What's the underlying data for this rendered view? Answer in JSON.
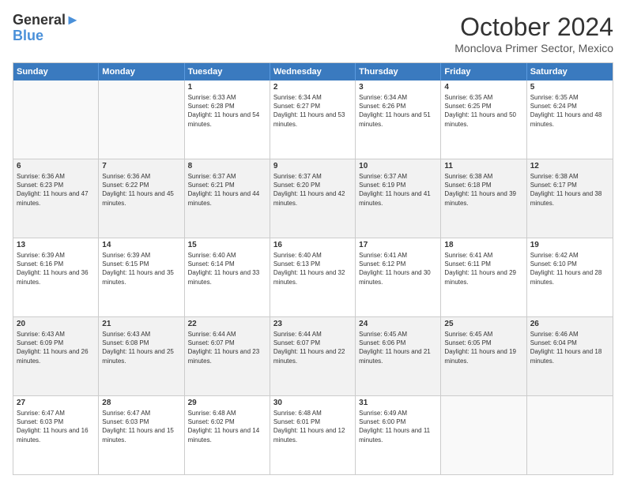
{
  "header": {
    "logo_line1": "General",
    "logo_line2": "Blue",
    "month": "October 2024",
    "location": "Monclova Primer Sector, Mexico"
  },
  "weekdays": [
    "Sunday",
    "Monday",
    "Tuesday",
    "Wednesday",
    "Thursday",
    "Friday",
    "Saturday"
  ],
  "weeks": [
    [
      {
        "day": "",
        "info": "",
        "empty": true
      },
      {
        "day": "",
        "info": "",
        "empty": true
      },
      {
        "day": "1",
        "info": "Sunrise: 6:33 AM\nSunset: 6:28 PM\nDaylight: 11 hours and 54 minutes."
      },
      {
        "day": "2",
        "info": "Sunrise: 6:34 AM\nSunset: 6:27 PM\nDaylight: 11 hours and 53 minutes."
      },
      {
        "day": "3",
        "info": "Sunrise: 6:34 AM\nSunset: 6:26 PM\nDaylight: 11 hours and 51 minutes."
      },
      {
        "day": "4",
        "info": "Sunrise: 6:35 AM\nSunset: 6:25 PM\nDaylight: 11 hours and 50 minutes."
      },
      {
        "day": "5",
        "info": "Sunrise: 6:35 AM\nSunset: 6:24 PM\nDaylight: 11 hours and 48 minutes."
      }
    ],
    [
      {
        "day": "6",
        "info": "Sunrise: 6:36 AM\nSunset: 6:23 PM\nDaylight: 11 hours and 47 minutes."
      },
      {
        "day": "7",
        "info": "Sunrise: 6:36 AM\nSunset: 6:22 PM\nDaylight: 11 hours and 45 minutes."
      },
      {
        "day": "8",
        "info": "Sunrise: 6:37 AM\nSunset: 6:21 PM\nDaylight: 11 hours and 44 minutes."
      },
      {
        "day": "9",
        "info": "Sunrise: 6:37 AM\nSunset: 6:20 PM\nDaylight: 11 hours and 42 minutes."
      },
      {
        "day": "10",
        "info": "Sunrise: 6:37 AM\nSunset: 6:19 PM\nDaylight: 11 hours and 41 minutes."
      },
      {
        "day": "11",
        "info": "Sunrise: 6:38 AM\nSunset: 6:18 PM\nDaylight: 11 hours and 39 minutes."
      },
      {
        "day": "12",
        "info": "Sunrise: 6:38 AM\nSunset: 6:17 PM\nDaylight: 11 hours and 38 minutes."
      }
    ],
    [
      {
        "day": "13",
        "info": "Sunrise: 6:39 AM\nSunset: 6:16 PM\nDaylight: 11 hours and 36 minutes."
      },
      {
        "day": "14",
        "info": "Sunrise: 6:39 AM\nSunset: 6:15 PM\nDaylight: 11 hours and 35 minutes."
      },
      {
        "day": "15",
        "info": "Sunrise: 6:40 AM\nSunset: 6:14 PM\nDaylight: 11 hours and 33 minutes."
      },
      {
        "day": "16",
        "info": "Sunrise: 6:40 AM\nSunset: 6:13 PM\nDaylight: 11 hours and 32 minutes."
      },
      {
        "day": "17",
        "info": "Sunrise: 6:41 AM\nSunset: 6:12 PM\nDaylight: 11 hours and 30 minutes."
      },
      {
        "day": "18",
        "info": "Sunrise: 6:41 AM\nSunset: 6:11 PM\nDaylight: 11 hours and 29 minutes."
      },
      {
        "day": "19",
        "info": "Sunrise: 6:42 AM\nSunset: 6:10 PM\nDaylight: 11 hours and 28 minutes."
      }
    ],
    [
      {
        "day": "20",
        "info": "Sunrise: 6:43 AM\nSunset: 6:09 PM\nDaylight: 11 hours and 26 minutes."
      },
      {
        "day": "21",
        "info": "Sunrise: 6:43 AM\nSunset: 6:08 PM\nDaylight: 11 hours and 25 minutes."
      },
      {
        "day": "22",
        "info": "Sunrise: 6:44 AM\nSunset: 6:07 PM\nDaylight: 11 hours and 23 minutes."
      },
      {
        "day": "23",
        "info": "Sunrise: 6:44 AM\nSunset: 6:07 PM\nDaylight: 11 hours and 22 minutes."
      },
      {
        "day": "24",
        "info": "Sunrise: 6:45 AM\nSunset: 6:06 PM\nDaylight: 11 hours and 21 minutes."
      },
      {
        "day": "25",
        "info": "Sunrise: 6:45 AM\nSunset: 6:05 PM\nDaylight: 11 hours and 19 minutes."
      },
      {
        "day": "26",
        "info": "Sunrise: 6:46 AM\nSunset: 6:04 PM\nDaylight: 11 hours and 18 minutes."
      }
    ],
    [
      {
        "day": "27",
        "info": "Sunrise: 6:47 AM\nSunset: 6:03 PM\nDaylight: 11 hours and 16 minutes."
      },
      {
        "day": "28",
        "info": "Sunrise: 6:47 AM\nSunset: 6:03 PM\nDaylight: 11 hours and 15 minutes."
      },
      {
        "day": "29",
        "info": "Sunrise: 6:48 AM\nSunset: 6:02 PM\nDaylight: 11 hours and 14 minutes."
      },
      {
        "day": "30",
        "info": "Sunrise: 6:48 AM\nSunset: 6:01 PM\nDaylight: 11 hours and 12 minutes."
      },
      {
        "day": "31",
        "info": "Sunrise: 6:49 AM\nSunset: 6:00 PM\nDaylight: 11 hours and 11 minutes."
      },
      {
        "day": "",
        "info": "",
        "empty": true
      },
      {
        "day": "",
        "info": "",
        "empty": true
      }
    ]
  ]
}
